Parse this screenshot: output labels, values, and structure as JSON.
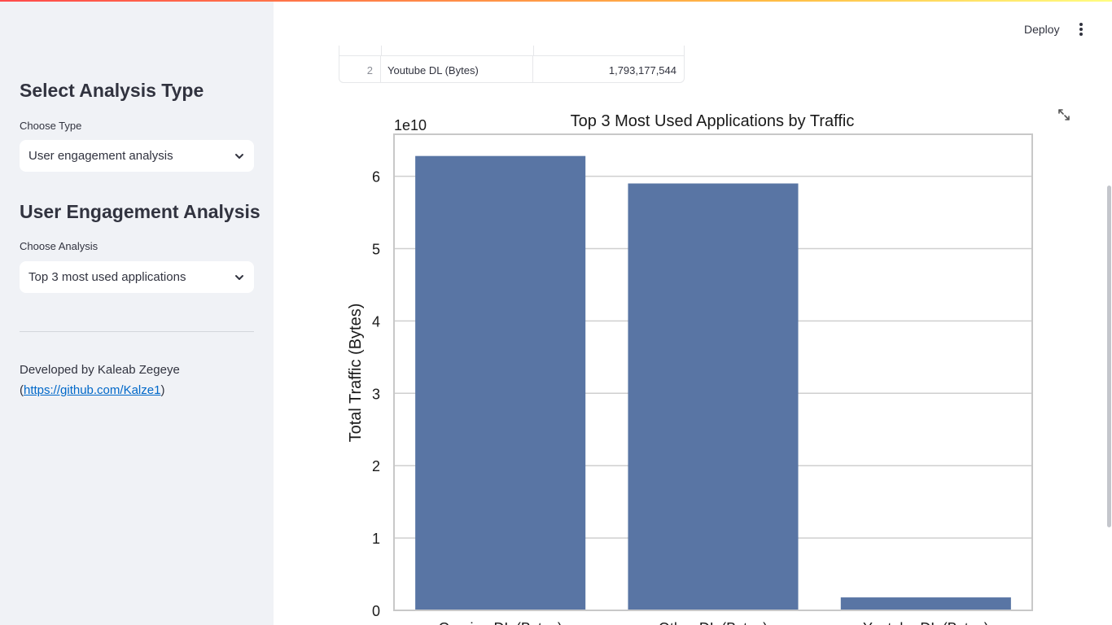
{
  "sidebar": {
    "analysis_type_heading": "Select Analysis Type",
    "type_label": "Choose Type",
    "type_value": "User engagement analysis",
    "engagement_heading": "User Engagement Analysis",
    "analysis_label": "Choose Analysis",
    "analysis_value": "Top 3 most used applications",
    "credit_text": "Developed by Kaleab Zegeye",
    "credit_link": "https://github.com/Kalze1"
  },
  "header": {
    "deploy_label": "Deploy",
    "menu_icon": "kebab-menu-icon"
  },
  "table": {
    "rows": [
      {
        "index": "2",
        "name": "Youtube DL (Bytes)",
        "value": "1,793,177,544"
      }
    ]
  },
  "colors": {
    "bar": "#5975a4",
    "sidebar_bg": "#f0f2f6",
    "link": "#0068c9"
  },
  "chart_data": {
    "type": "bar",
    "title": "Top 3 Most Used Applications by Traffic",
    "ylabel": "Total Traffic (Bytes)",
    "xlabel": "",
    "offset_label": "1e10",
    "categories": [
      "Gaming DL (Bytes)",
      "Other DL (Bytes)",
      "Youtube DL (Bytes)"
    ],
    "values": [
      62.8,
      59.0,
      1.79
    ],
    "value_unit": "1e9 bytes",
    "ylim": [
      0,
      65.8
    ],
    "yticks": [
      0,
      10,
      20,
      30,
      40,
      50,
      60
    ],
    "yticklabels": [
      "0",
      "1",
      "2",
      "3",
      "4",
      "5",
      "6"
    ],
    "grid": true
  }
}
